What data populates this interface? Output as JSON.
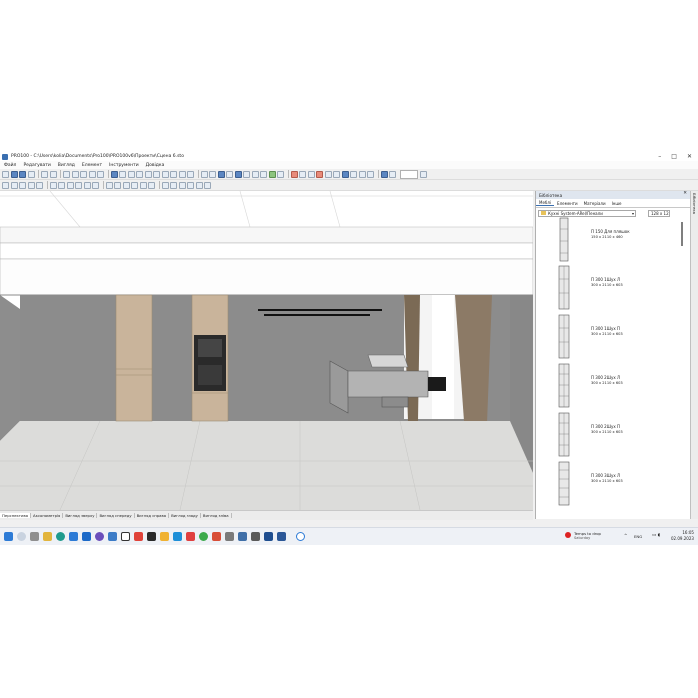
{
  "window": {
    "title": "PRO100 - C:\\Users\\kolia\\Documents\\Pro100\\PRO100v6\\Проекти\\Сцена 6.sto",
    "controls": [
      "–",
      "□",
      "✕"
    ]
  },
  "menu": [
    "Файл",
    "Редагувати",
    "Вигляд",
    "Елемент",
    "Інструменти",
    "Довідка"
  ],
  "toolbar": {
    "row1_icons": [
      "new-icon",
      "open-icon",
      "save-icon",
      "save-as-icon",
      "print-icon",
      "preview-icon",
      "cut-icon",
      "copy-icon",
      "paste-icon",
      "undo-icon",
      "redo-icon",
      "color-icon",
      "texture-icon",
      "render-icon",
      "dimension-icon",
      "sum-icon"
    ],
    "row2_icons": [
      "select-icon",
      "move-icon",
      "rotate-icon",
      "pipette-icon",
      "paint-icon",
      "zoom-icon",
      "pan-icon"
    ]
  },
  "view_tabs": [
    "Перспектива",
    "Аксонометрія",
    "Вигляд зверху",
    "Вигляд спереду",
    "Вигляд справа",
    "Вигляд ззаду",
    "Вигляд зліва"
  ],
  "library": {
    "title": "Бібліотека",
    "tabs": [
      "Меблі",
      "Елементи",
      "Матеріали",
      "Інше"
    ],
    "path": "Кухні System-ARel/Пенали",
    "size": "128 x 12",
    "items": [
      {
        "name": "П 150 Для пляшок",
        "size": "150 x 2110 x 460"
      },
      {
        "name": "П 300 1Шух Л",
        "size": "300 x 2110 x 603"
      },
      {
        "name": "П 300 1Шух П",
        "size": "300 x 2110 x 603"
      },
      {
        "name": "П 300 2Шух Л",
        "size": "300 x 2110 x 603"
      },
      {
        "name": "П 300 2Шух П",
        "size": "300 x 2110 x 603"
      },
      {
        "name": "П 300 3Шух Л",
        "size": "300 x 2110 x 603"
      }
    ]
  },
  "side_panel": {
    "label": "Бібліотека"
  },
  "taskbar": {
    "weather_temp": "Temps to drop",
    "weather_day": "Saturday",
    "lang": "ENG",
    "time": "16:05",
    "date": "02.09.2023"
  },
  "colors": {
    "accent": "#3a6fb0",
    "wall": "#8a8a8a",
    "wood": "#c9b49b",
    "floor": "#d8d8d6"
  }
}
